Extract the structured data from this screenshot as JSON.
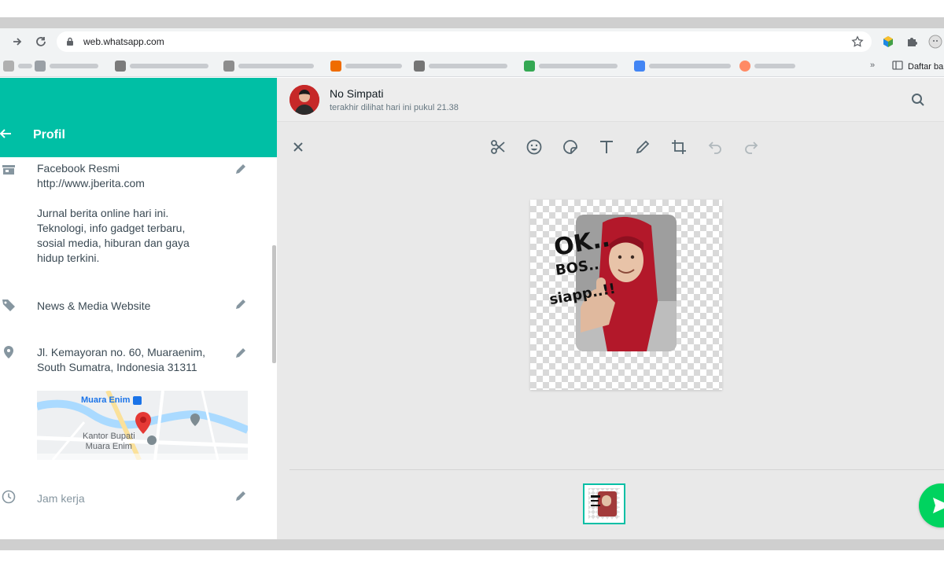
{
  "browser": {
    "url": "web.whatsapp.com",
    "bookmarks_more": "»",
    "bookmarks_list_label": "Daftar ba"
  },
  "profile": {
    "title": "Profil",
    "description": "Facebook Resmi\nhttp://www.jberita.com\n\nJurnal berita online hari ini.\nTeknologi, info gadget terbaru,\nsosial media, hiburan dan gaya\nhidup terkini.",
    "category": "News & Media Website",
    "address": "Jl. Kemayoran no. 60, Muaraenim,\nSouth Sumatra, Indonesia 31311",
    "map": {
      "place_1": "Muara Enim",
      "place_2": "Kantor Bupati\nMuara Enim"
    },
    "hours_placeholder": "Jam kerja"
  },
  "chat": {
    "contact_name": "No Simpati",
    "contact_status": "terakhir dilihat hari ini pukul 21.38"
  },
  "editor": {
    "tools": [
      "scissors-icon",
      "emoji-icon",
      "sticker-icon",
      "text-icon",
      "pencil-icon",
      "crop-icon",
      "undo-icon",
      "redo-icon"
    ],
    "sticker_lines": [
      "OK..",
      "BOS..",
      "siapp..!!"
    ]
  },
  "colors": {
    "accent": "#00bfa5",
    "send": "#00d35f",
    "panel": "#e9e9e9"
  }
}
